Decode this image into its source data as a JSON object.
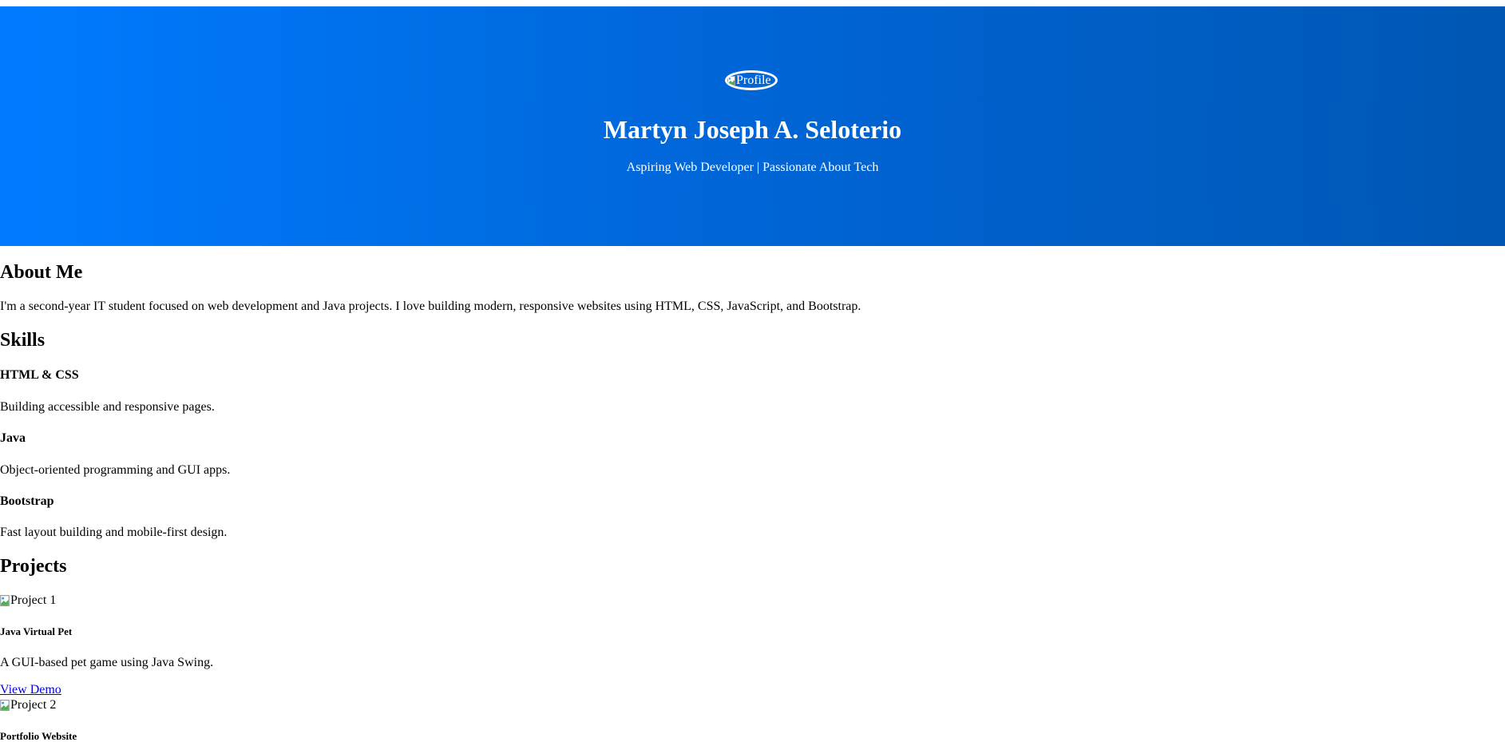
{
  "hero": {
    "profile_alt": "Profile",
    "name": "Martyn Joseph A. Seloterio",
    "tagline": "Aspiring Web Developer | Passionate About Tech",
    "gradient_start": "#007bff",
    "gradient_end": "#0057b3"
  },
  "about": {
    "title": "About Me",
    "text": "I'm a second-year IT student focused on web development and Java projects. I love building modern, responsive websites using HTML, CSS, JavaScript, and Bootstrap."
  },
  "skills": {
    "title": "Skills",
    "items": [
      {
        "name": "HTML & CSS",
        "description": "Building accessible and responsive pages."
      },
      {
        "name": "Java",
        "description": "Object-oriented programming and GUI apps."
      },
      {
        "name": "Bootstrap",
        "description": "Fast layout building and mobile-first design."
      }
    ]
  },
  "projects": {
    "title": "Projects",
    "items": [
      {
        "image_alt": "Project 1",
        "name": "Java Virtual Pet",
        "description": "A GUI-based pet game using Java Swing.",
        "link_label": "View Demo"
      },
      {
        "image_alt": "Project 2",
        "name": "Portfolio Website"
      }
    ]
  },
  "link_color": "#0000ee",
  "broken_image_icon": "broken-image-icon"
}
